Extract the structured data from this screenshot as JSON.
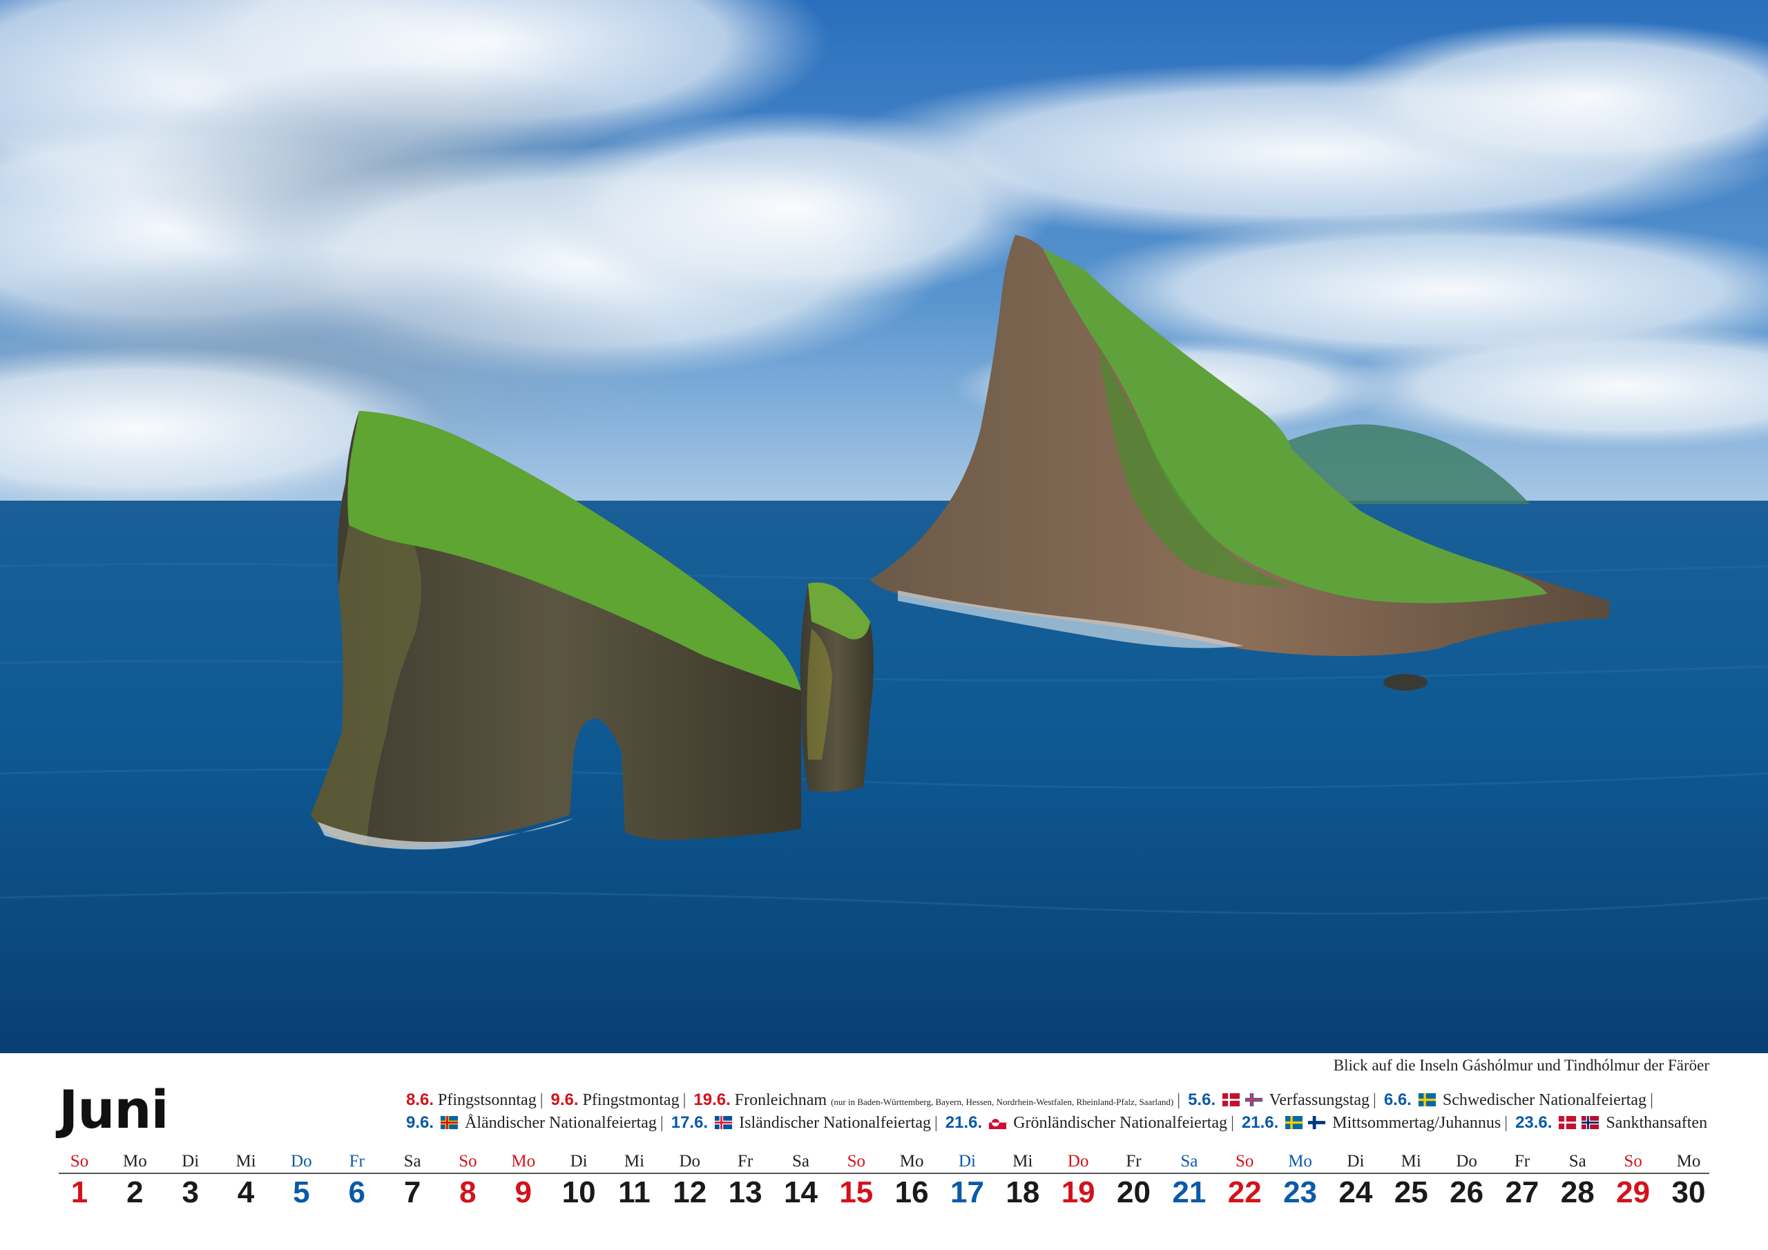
{
  "caption": "Blick auf die Inseln Gáshólmur und Tindhólmur der Färöer",
  "month": "Juni",
  "holidays": {
    "line1": [
      {
        "date": "8.6.",
        "color": "red",
        "text": "Pfingstsonntag"
      },
      {
        "date": "9.6.",
        "color": "red",
        "text": "Pfingstmontag"
      },
      {
        "date": "19.6.",
        "color": "red",
        "text": "Fronleichnam",
        "note": "(nur in Baden-Württemberg, Bayern, Hessen, Nordrhein-Westfalen, Rheinland-Pfalz, Saarland)"
      },
      {
        "date": "5.6.",
        "color": "blue",
        "flags": [
          "denmark",
          "faroe"
        ],
        "text": "Verfassungstag"
      },
      {
        "date": "6.6.",
        "color": "blue",
        "flags": [
          "sweden"
        ],
        "text": "Schwedischer Nationalfeiertag"
      }
    ],
    "line2": [
      {
        "date": "9.6.",
        "color": "blue",
        "flags": [
          "aland"
        ],
        "text": "Åländischer Nationalfeiertag"
      },
      {
        "date": "17.6.",
        "color": "blue",
        "flags": [
          "iceland"
        ],
        "text": "Isländischer Nationalfeiertag"
      },
      {
        "date": "21.6.",
        "color": "blue",
        "flags": [
          "greenland"
        ],
        "text": "Grönländischer Nationalfeiertag"
      },
      {
        "date": "21.6.",
        "color": "blue",
        "flags": [
          "sweden",
          "finland"
        ],
        "text": "Mittsommertag/Juhannus"
      },
      {
        "date": "23.6.",
        "color": "blue",
        "flags": [
          "denmark",
          "norway"
        ],
        "text": "Sankthansaften"
      }
    ]
  },
  "days": [
    {
      "n": "1",
      "d": "So",
      "c": "red"
    },
    {
      "n": "2",
      "d": "Mo",
      "c": ""
    },
    {
      "n": "3",
      "d": "Di",
      "c": ""
    },
    {
      "n": "4",
      "d": "Mi",
      "c": ""
    },
    {
      "n": "5",
      "d": "Do",
      "c": "blue"
    },
    {
      "n": "6",
      "d": "Fr",
      "c": "blue"
    },
    {
      "n": "7",
      "d": "Sa",
      "c": ""
    },
    {
      "n": "8",
      "d": "So",
      "c": "red"
    },
    {
      "n": "9",
      "d": "Mo",
      "c": "red"
    },
    {
      "n": "10",
      "d": "Di",
      "c": ""
    },
    {
      "n": "11",
      "d": "Mi",
      "c": ""
    },
    {
      "n": "12",
      "d": "Do",
      "c": ""
    },
    {
      "n": "13",
      "d": "Fr",
      "c": ""
    },
    {
      "n": "14",
      "d": "Sa",
      "c": ""
    },
    {
      "n": "15",
      "d": "So",
      "c": "red"
    },
    {
      "n": "16",
      "d": "Mo",
      "c": ""
    },
    {
      "n": "17",
      "d": "Di",
      "c": "blue"
    },
    {
      "n": "18",
      "d": "Mi",
      "c": ""
    },
    {
      "n": "19",
      "d": "Do",
      "c": "red"
    },
    {
      "n": "20",
      "d": "Fr",
      "c": ""
    },
    {
      "n": "21",
      "d": "Sa",
      "c": "blue"
    },
    {
      "n": "22",
      "d": "So",
      "c": "red"
    },
    {
      "n": "23",
      "d": "Mo",
      "c": "blue"
    },
    {
      "n": "24",
      "d": "Di",
      "c": ""
    },
    {
      "n": "25",
      "d": "Mi",
      "c": ""
    },
    {
      "n": "26",
      "d": "Do",
      "c": ""
    },
    {
      "n": "27",
      "d": "Fr",
      "c": ""
    },
    {
      "n": "28",
      "d": "Sa",
      "c": ""
    },
    {
      "n": "29",
      "d": "So",
      "c": "red"
    },
    {
      "n": "30",
      "d": "Mo",
      "c": ""
    }
  ]
}
